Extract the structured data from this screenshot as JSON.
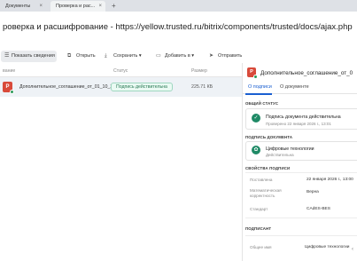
{
  "browser": {
    "tabs": [
      {
        "label": "Документы"
      },
      {
        "label": "Проверка и рас..."
      }
    ],
    "new_tab": "+",
    "close": "×"
  },
  "page": {
    "title": "роверка и расшифрование - https://yellow.trusted.ru/bitrix/components/trusted/docs/ajax.php"
  },
  "toolbar": {
    "show_details": "Показать сведения",
    "open": "Открыть",
    "save": "Сохранить",
    "add": "Добавить в",
    "send": "Отправить"
  },
  "list": {
    "columns": {
      "name": "вание",
      "status": "Статус",
      "size": "Размер"
    },
    "rows": [
      {
        "icon_letter": "P",
        "name": "Дополнительное_соглашение_от_01_10_20...",
        "status": "Подпись действительна",
        "size": "225.71 КБ"
      }
    ]
  },
  "panel": {
    "icon_letter": "P",
    "title": "Дополнительное_соглашение_от_0",
    "tabs": {
      "signature": "О подписи",
      "document": "О документе"
    },
    "general_status": {
      "heading": "ОБЩИЙ СТАТУС",
      "line1": "Подпись документа действительна",
      "line2": "Проверено 22 января 2026 г., 13:01"
    },
    "signer": {
      "heading": "ПОДПИСЬ ДОКУМЕНТА",
      "org": "Цифровые технологии",
      "status": "Действительна"
    },
    "props": {
      "heading": "СВОЙСТВА ПОДПИСИ",
      "rows": [
        {
          "label": "Поставлена",
          "value": "22 января 2026 г., 13:00"
        },
        {
          "label": "Математическая корректность",
          "value": "Верна"
        },
        {
          "label": "Стандарт",
          "value": "CAdES-BES"
        }
      ]
    },
    "signatory": {
      "heading": "ПОДПИСАНТ",
      "rows": [
        {
          "label": "Общее имя",
          "value": "Цифровые технологии"
        }
      ]
    }
  },
  "colors": {
    "accent": "#1a5fd1",
    "valid": "#1f8a66",
    "file_icon": "#d84a3a"
  }
}
